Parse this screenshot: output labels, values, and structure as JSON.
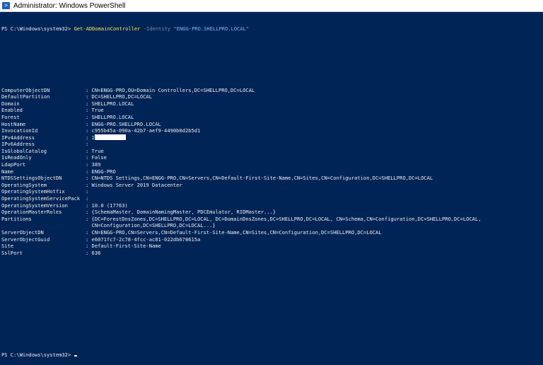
{
  "window": {
    "title": "Administrator: Windows PowerShell",
    "icon": "powershell-icon"
  },
  "command": {
    "prompt": "PS C:\\Windows\\system32> ",
    "cmdlet": "Get-ADDomainController",
    "param": " -Identity ",
    "arg": "\"ENGG-PRO.SHELLPRO.LOCAL\""
  },
  "properties": [
    {
      "key": "ComputerObjectDN",
      "sep": ": ",
      "value": "CN=ENGG-PRO,OU=Domain Controllers,DC=SHELLPRO,DC=LOCAL"
    },
    {
      "key": "DefaultPartition",
      "sep": ": ",
      "value": "DC=SHELLPRO,DC=LOCAL"
    },
    {
      "key": "Domain",
      "sep": ": ",
      "value": "SHELLPRO.LOCAL"
    },
    {
      "key": "Enabled",
      "sep": ": ",
      "value": "True"
    },
    {
      "key": "Forest",
      "sep": ": ",
      "value": "SHELLPRO.LOCAL"
    },
    {
      "key": "HostName",
      "sep": ": ",
      "value": "ENGG-PRO.SHELLPRO.LOCAL"
    },
    {
      "key": "InvocationId",
      "sep": ": ",
      "value": "c955b45a-090a-42b7-aef9-4490b0d2b5d1"
    },
    {
      "key": "IPv4Address",
      "sep": ": ",
      "value": "1"
    },
    {
      "key": "IPv6Address",
      "sep": ":",
      "value": ""
    },
    {
      "key": "IsGlobalCatalog",
      "sep": ": ",
      "value": "True"
    },
    {
      "key": "IsReadOnly",
      "sep": ": ",
      "value": "False"
    },
    {
      "key": "LdapPort",
      "sep": ": ",
      "value": "389"
    },
    {
      "key": "Name",
      "sep": ": ",
      "value": "ENGG-PRO"
    },
    {
      "key": "NTDSSettingsObjectDN",
      "sep": ": ",
      "value": "CN=NTDS Settings,CN=ENGG-PRO,CN=Servers,CN=Default-First-Site-Name,CN=Sites,CN=Configuration,DC=SHELLPRO,DC=LOCAL"
    },
    {
      "key": "OperatingSystem",
      "sep": ": ",
      "value": "Windows Server 2019 Datacenter"
    },
    {
      "key": "OperatingSystemHotfix",
      "sep": ":",
      "value": ""
    },
    {
      "key": "OperatingSystemServicePack",
      "sep": ":",
      "value": ""
    },
    {
      "key": "OperatingSystemVersion",
      "sep": ": ",
      "value": "10.0 (17763)"
    },
    {
      "key": "OperationMasterRoles",
      "sep": ": ",
      "value": "{SchemaMaster, DomainNamingMaster, PDCEmulator, RIDMaster...}"
    },
    {
      "key": "Partitions",
      "sep": ": ",
      "value": "{DC=ForestDnsZones,DC=SHELLPRO,DC=LOCAL, DC=DomainDnsZones,DC=SHELLPRO,DC=LOCAL, CN=Schema,CN=Configuration,DC=SHELLPRO,DC=LOCAL,"
    },
    {
      "key": "",
      "sep": "  ",
      "value": "CN=Configuration,DC=SHELLPRO,DC=LOCAL...}"
    },
    {
      "key": "ServerObjectDN",
      "sep": ": ",
      "value": "CN=ENGG-PRO,CN=Servers,CN=Default-First-Site-Name,CN=Sites,CN=Configuration,DC=SHELLPRO,DC=LOCAL"
    },
    {
      "key": "ServerObjectGuid",
      "sep": ": ",
      "value": "e6071fc7-2c78-4fcc-ac81-022db678615a"
    },
    {
      "key": "Site",
      "sep": ": ",
      "value": "Default-First-Site-Name"
    },
    {
      "key": "SslPort",
      "sep": ": ",
      "value": "636"
    }
  ],
  "final_prompt": "PS C:\\Windows\\system32> "
}
